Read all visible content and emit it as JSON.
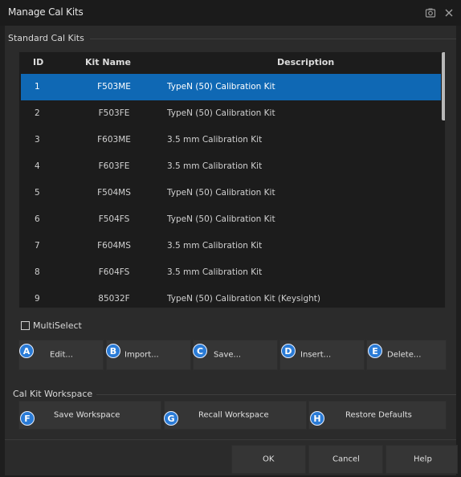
{
  "window": {
    "title": "Manage Cal Kits"
  },
  "standard_group": {
    "label": "Standard Cal Kits"
  },
  "table": {
    "headers": {
      "id": "ID",
      "kit_name": "Kit Name",
      "description": "Description"
    },
    "rows": [
      {
        "id": "1",
        "kit_name": "F503ME",
        "description": "TypeN (50) Calibration Kit"
      },
      {
        "id": "2",
        "kit_name": "F503FE",
        "description": "TypeN (50) Calibration Kit"
      },
      {
        "id": "3",
        "kit_name": "F603ME",
        "description": "3.5 mm Calibration Kit"
      },
      {
        "id": "4",
        "kit_name": "F603FE",
        "description": "3.5 mm Calibration Kit"
      },
      {
        "id": "5",
        "kit_name": "F504MS",
        "description": "TypeN (50) Calibration Kit"
      },
      {
        "id": "6",
        "kit_name": "F504FS",
        "description": "TypeN (50) Calibration Kit"
      },
      {
        "id": "7",
        "kit_name": "F604MS",
        "description": "3.5 mm Calibration Kit"
      },
      {
        "id": "8",
        "kit_name": "F604FS",
        "description": "3.5 mm Calibration Kit"
      },
      {
        "id": "9",
        "kit_name": "85032F",
        "description": "TypeN (50) Calibration Kit (Keysight)"
      }
    ],
    "selected_row": "1"
  },
  "multiselect": {
    "label": "MultiSelect",
    "checked": false
  },
  "kit_buttons": {
    "edit": {
      "label": "Edit...",
      "badge": "A"
    },
    "import": {
      "label": "Import...",
      "badge": "B"
    },
    "save": {
      "label": "Save...",
      "badge": "C"
    },
    "insert": {
      "label": "Insert...",
      "badge": "D"
    },
    "delete": {
      "label": "Delete...",
      "badge": "E"
    }
  },
  "workspace_group": {
    "label": "Cal Kit Workspace"
  },
  "workspace_buttons": {
    "save_workspace": {
      "label": "Save Workspace",
      "badge": "F"
    },
    "recall_workspace": {
      "label": "Recall Workspace",
      "badge": "G"
    },
    "restore_defaults": {
      "label": "Restore Defaults",
      "badge": "H"
    }
  },
  "footer": {
    "ok": "OK",
    "cancel": "Cancel",
    "help": "Help"
  },
  "colors": {
    "selection": "#0f68b4",
    "badge": "#2a7bd6",
    "background": "#2b2b2b",
    "table_background": "#1c1c1c"
  },
  "icons": {
    "titlebar": [
      "screenshot-icon",
      "close-icon"
    ]
  }
}
